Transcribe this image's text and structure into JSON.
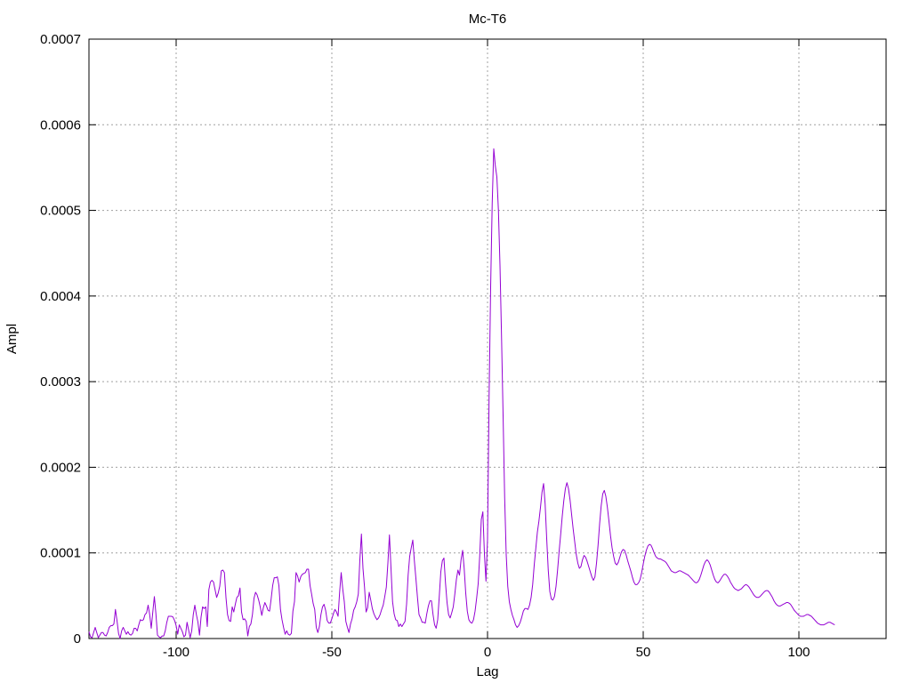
{
  "chart_data": {
    "type": "line",
    "title": "Mc-T6",
    "xlabel": "Lag",
    "ylabel": "Ampl",
    "xlim": [
      -128,
      128
    ],
    "ylim": [
      0,
      0.0007
    ],
    "xticks": [
      -100,
      -50,
      0,
      50,
      100
    ],
    "yticks": [
      0,
      0.0001,
      0.0002,
      0.0003,
      0.0004,
      0.0005,
      0.0006,
      0.0007
    ],
    "xtick_labels": [
      "-100",
      "-50",
      "0",
      "50",
      "100"
    ],
    "ytick_labels": [
      "0",
      "0.0001",
      "0.0002",
      "0.0003",
      "0.0004",
      "0.0005",
      "0.0006",
      "0.0007"
    ],
    "grid": true,
    "legend": "none",
    "series_color": "#9400d3",
    "x": [
      -128,
      -127.5,
      -127,
      -126.5,
      -126,
      -125.5,
      -125,
      -124.5,
      -124,
      -123.5,
      -123,
      -122.5,
      -122,
      -121.5,
      -121,
      -120.5,
      -120,
      -119.5,
      -119,
      -118.5,
      -118,
      -117.5,
      -117,
      -116.5,
      -116,
      -115.5,
      -115,
      -114.5,
      -114,
      -113.5,
      -113,
      -112.5,
      -112,
      -111.5,
      -111,
      -110.5,
      -110,
      -109.5,
      -109,
      -108.5,
      -108,
      -107.5,
      -107,
      -106.5,
      -106,
      -105.5,
      -105,
      -104.5,
      -104,
      -103.5,
      -103,
      -102.5,
      -102,
      -101.5,
      -101,
      -100.5,
      -100,
      -99.5,
      -99,
      -98.5,
      -98,
      -97.5,
      -97,
      -96.5,
      -96,
      -95.5,
      -95,
      -94.5,
      -94,
      -93.5,
      -93,
      -92.5,
      -92,
      -91.5,
      -91,
      -90.5,
      -90,
      -89.5,
      -89,
      -88.5,
      -88,
      -87.5,
      -87,
      -86.5,
      -86,
      -85.5,
      -85,
      -84.5,
      -84,
      -83.5,
      -83,
      -82.5,
      -82,
      -81.5,
      -81,
      -80.5,
      -80,
      -79.5,
      -79,
      -78.5,
      -78,
      -77.5,
      -77,
      -76.5,
      -76,
      -75.5,
      -75,
      -74.5,
      -74,
      -73.5,
      -73,
      -72.5,
      -72,
      -71.5,
      -71,
      -70.5,
      -70,
      -69.5,
      -69,
      -68.5,
      -68,
      -67.5,
      -67,
      -66.5,
      -66,
      -65.5,
      -65,
      -64.5,
      -64,
      -63.5,
      -63,
      -62.5,
      -62,
      -61.5,
      -61,
      -60.5,
      -60,
      -59.5,
      -59,
      -58.5,
      -58,
      -57.5,
      -57,
      -56.5,
      -56,
      -55.5,
      -55,
      -54.5,
      -54,
      -53.5,
      -53,
      -52.5,
      -52,
      -51.5,
      -51,
      -50.5,
      -50,
      -49.5,
      -49,
      -48.5,
      -48,
      -47.5,
      -47,
      -46.5,
      -46,
      -45.5,
      -45,
      -44.5,
      -44,
      -43.5,
      -43,
      -42.5,
      -42,
      -41.5,
      -41,
      -40.5,
      -40,
      -39.5,
      -39,
      -38.5,
      -38,
      -37.5,
      -37,
      -36.5,
      -36,
      -35.5,
      -35,
      -34.5,
      -34,
      -33.5,
      -33,
      -32.5,
      -32,
      -31.5,
      -31,
      -30.5,
      -30,
      -29.5,
      -29,
      -28.5,
      -28,
      -27.5,
      -27,
      -26.5,
      -26,
      -25.5,
      -25,
      -24.5,
      -24,
      -23.5,
      -23,
      -22.5,
      -22,
      -21.5,
      -21,
      -20.5,
      -20,
      -19.5,
      -19,
      -18.5,
      -18,
      -17.5,
      -17,
      -16.5,
      -16,
      -15.5,
      -15,
      -14.5,
      -14,
      -13.5,
      -13,
      -12.5,
      -12,
      -11.5,
      -11,
      -10.5,
      -10,
      -9.5,
      -9,
      -8.5,
      -8,
      -7.5,
      -7,
      -6.5,
      -6,
      -5.5,
      -5,
      -4.5,
      -4,
      -3.5,
      -3,
      -2.5,
      -2,
      -1.5,
      -1,
      -0.5,
      0,
      0.5,
      1,
      1.5,
      2,
      2.5,
      3,
      3.5,
      4,
      4.5,
      5,
      5.5,
      6,
      6.5,
      7,
      7.5,
      8,
      8.5,
      9,
      9.5,
      10,
      10.5,
      11,
      11.5,
      12,
      12.5,
      13,
      13.5,
      14,
      14.5,
      15,
      15.5,
      16,
      16.5,
      17,
      17.5,
      18,
      18.5,
      19,
      19.5,
      20,
      20.5,
      21,
      21.5,
      22,
      22.5,
      23,
      23.5,
      24,
      24.5,
      25,
      25.5,
      26,
      26.5,
      27,
      27.5,
      28,
      28.5,
      29,
      29.5,
      30,
      30.5,
      31,
      31.5,
      32,
      32.5,
      33,
      33.5,
      34,
      34.5,
      35,
      35.5,
      36,
      36.5,
      37,
      37.5,
      38,
      38.5,
      39,
      39.5,
      40,
      40.5,
      41,
      41.5,
      42,
      42.5,
      43,
      43.5,
      44,
      44.5,
      45,
      45.5,
      46,
      46.5,
      47,
      47.5,
      48,
      48.5,
      49,
      49.5,
      50,
      50.5,
      51,
      51.5,
      52,
      52.5,
      53,
      53.5,
      54,
      54.5,
      55,
      55.5,
      56,
      56.5,
      57,
      57.5,
      58,
      58.5,
      59,
      59.5,
      60,
      60.5,
      61,
      61.5,
      62,
      62.5,
      63,
      63.5,
      64,
      64.5,
      65,
      65.5,
      66,
      66.5,
      67,
      67.5,
      68,
      68.5,
      69,
      69.5,
      70,
      70.5,
      71,
      71.5,
      72,
      72.5,
      73,
      73.5,
      74,
      74.5,
      75,
      75.5,
      76,
      76.5,
      77,
      77.5,
      78,
      78.5,
      79,
      79.5,
      80,
      80.5,
      81,
      81.5,
      82,
      82.5,
      83,
      83.5,
      84,
      84.5,
      85,
      85.5,
      86,
      86.5,
      87,
      87.5,
      88,
      88.5,
      89,
      89.5,
      90,
      90.5,
      91,
      91.5,
      92,
      92.5,
      93,
      93.5,
      94,
      94.5,
      95,
      95.5,
      96,
      96.5,
      97,
      97.5,
      98,
      98.5,
      99,
      99.5,
      100,
      100.5,
      101,
      101.5,
      102,
      102.5,
      103,
      103.5,
      104,
      104.5,
      105,
      105.5,
      106,
      106.5,
      107,
      107.5,
      108,
      108.5,
      109,
      109.5,
      110,
      110.5,
      111,
      111.5,
      112,
      112.5,
      113,
      113.5,
      114,
      114.5,
      115,
      115.5,
      116,
      116.5,
      117,
      117.5,
      118,
      118.5,
      119,
      119.5,
      120,
      120.5,
      121,
      121.5,
      122,
      122.5,
      123,
      123.5,
      124,
      124.5,
      125,
      125.5,
      126,
      126.5,
      127,
      127.5,
      128
    ],
    "y": [
      8e-06,
      2e-06,
      1e-06,
      7e-06,
      1.3e-05,
      7e-06,
      1e-06,
      4e-06,
      7e-06,
      7e-06,
      4e-06,
      3e-06,
      7e-06,
      1.3e-05,
      1.5e-05,
      1.5e-05,
      1.7e-05,
      3.4e-05,
      2.1e-05,
      6e-06,
      0,
      9e-06,
      1.3e-05,
      9e-06,
      5e-06,
      8e-06,
      5e-06,
      4e-06,
      6e-06,
      1.2e-05,
      1.2e-05,
      9e-06,
      1.6e-05,
      2.2e-05,
      2.1e-05,
      2.2e-05,
      2.8e-05,
      3e-05,
      3.9e-05,
      2.8e-05,
      1.2e-05,
      3.1e-05,
      4.9e-05,
      2.9e-05,
      4e-06,
      2e-06,
      1e-06,
      3e-06,
      3e-06,
      9e-06,
      1.9e-05,
      2.6e-05,
      2.6e-05,
      2.6e-05,
      2.5e-05,
      2.1e-05,
      1.5e-05,
      5e-06,
      1.6e-05,
      1.2e-05,
      8e-06,
      2e-06,
      4e-06,
      1.9e-05,
      1e-05,
      1e-06,
      9e-06,
      2.8e-05,
      3.9e-05,
      2.8e-05,
      1.9e-05,
      4e-06,
      2.5e-05,
      3.7e-05,
      3.5e-05,
      3.7e-05,
      1.4e-05,
      5.7e-05,
      6.6e-05,
      6.8e-05,
      6.6e-05,
      5.7e-05,
      4.8e-05,
      5.3e-05,
      6.1e-05,
      7.9e-05,
      8e-05,
      7.7e-05,
      4.8e-05,
      2.8e-05,
      2.1e-05,
      2e-05,
      3.7e-05,
      3.1e-05,
      4e-05,
      4.8e-05,
      5e-05,
      5.9e-05,
      3.1e-05,
      2.2e-05,
      2.3e-05,
      2e-05,
      3e-06,
      1.4e-05,
      1.7e-05,
      2.8e-05,
      4.7e-05,
      5.4e-05,
      5.1e-05,
      4.5e-05,
      3.7e-05,
      2.7e-05,
      3.6e-05,
      4.2e-05,
      3.8e-05,
      3.3e-05,
      3.2e-05,
      4.6e-05,
      6.2e-05,
      7.1e-05,
      7.1e-05,
      7.2e-05,
      6.2e-05,
      3.4e-05,
      2.2e-05,
      1.3e-05,
      5e-06,
      9e-06,
      5e-06,
      4e-06,
      6e-06,
      3.2e-05,
      4.3e-05,
      7.7e-05,
      7.3e-05,
      6.6e-05,
      7.2e-05,
      7.5e-05,
      7.6e-05,
      7.7e-05,
      8.1e-05,
      8.1e-05,
      6.2e-05,
      5.2e-05,
      4.1e-05,
      3.4e-05,
      1.3e-05,
      7e-06,
      1.4e-05,
      2.8e-05,
      3.7e-05,
      4e-05,
      3.3e-05,
      2.1e-05,
      1.8e-05,
      1.8e-05,
      2.3e-05,
      2.9e-05,
      3.4e-05,
      3.1e-05,
      2.6e-05,
      5.4e-05,
      7.7e-05,
      5.8e-05,
      4.3e-05,
      2e-05,
      1.3e-05,
      7e-06,
      1.7e-05,
      2.3e-05,
      3.3e-05,
      3.7e-05,
      4.3e-05,
      5.2e-05,
      9.2e-05,
      0.000122,
      8.2e-05,
      6e-05,
      3.1e-05,
      3.6e-05,
      5.4e-05,
      4.5e-05,
      3.5e-05,
      2.9e-05,
      2.5e-05,
      2.2e-05,
      2.4e-05,
      2.8e-05,
      3.4e-05,
      3.9e-05,
      4.9e-05,
      6e-05,
      8.8e-05,
      0.000121,
      8.2e-05,
      4.3e-05,
      2.9e-05,
      2.2e-05,
      2.1e-05,
      1.4e-05,
      1.7e-05,
      1.4e-05,
      1.7e-05,
      2e-05,
      4e-05,
      7.4e-05,
      9.6e-05,
      0.000106,
      0.000115,
      9.1e-05,
      7e-05,
      4.8e-05,
      2.8e-05,
      2.4e-05,
      1.9e-05,
      1.9e-05,
      1.8e-05,
      2.9e-05,
      3.8e-05,
      4.4e-05,
      4.4e-05,
      2.8e-05,
      1.6e-05,
      1.2e-05,
      2.2e-05,
      4.9e-05,
      7.8e-05,
      9.1e-05,
      9.4e-05,
      6.5e-05,
      4.2e-05,
      2.8e-05,
      2.4e-05,
      3e-05,
      3.7e-05,
      5.2e-05,
      6.9e-05,
      8e-05,
      7.4e-05,
      9.2e-05,
      0.000103,
      8.2e-05,
      5.3e-05,
      3.2e-05,
      2.2e-05,
      1.9e-05,
      1.8e-05,
      2.2e-05,
      3.2e-05,
      4.7e-05,
      6.4e-05,
      9.7e-05,
      0.000139,
      0.000148,
      9.9e-05,
      6.7e-05,
      0.000116,
      0.000282,
      0.00041,
      0.000508,
      0.000572,
      0.000552,
      0.000539,
      0.0005,
      0.000436,
      0.000352,
      0.00026,
      0.000165,
      9.8e-05,
      6.1e-05,
      4.3e-05,
      3.4e-05,
      2.7e-05,
      2.2e-05,
      1.6e-05,
      1.3e-05,
      1.5e-05,
      1.9e-05,
      2.5e-05,
      3.2e-05,
      3.5e-05,
      3.5e-05,
      3.4e-05,
      3.9e-05,
      4.8e-05,
      6.3e-05,
      8.6e-05,
      0.000105,
      0.000124,
      0.000137,
      0.000153,
      0.000171,
      0.000181,
      0.000157,
      0.000117,
      8e-05,
      5.5e-05,
      4.6e-05,
      4.5e-05,
      4.9e-05,
      6.1e-05,
      8e-05,
      0.000102,
      0.000122,
      0.000143,
      0.000161,
      0.000175,
      0.000182,
      0.000175,
      0.000162,
      0.000145,
      0.000128,
      0.000113,
      9.8e-05,
      8.8e-05,
      8.2e-05,
      8.4e-05,
      9.2e-05,
      9.7e-05,
      9.5e-05,
      9e-05,
      8.4e-05,
      7.8e-05,
      7.2e-05,
      6.8e-05,
      7.2e-05,
      8.8e-05,
      0.000109,
      0.000134,
      0.000155,
      0.000169,
      0.000173,
      0.000166,
      0.000153,
      0.000137,
      0.00012,
      0.000106,
      9.6e-05,
      8.8e-05,
      8.6e-05,
      8.9e-05,
      9.5e-05,
      0.000101,
      0.000104,
      0.000103,
      9.8e-05,
      9.1e-05,
      8.5e-05,
      7.9e-05,
      7.2e-05,
      6.6e-05,
      6.3e-05,
      6.3e-05,
      6.5e-05,
      6.9e-05,
      7.7e-05,
      8.7e-05,
      9.6e-05,
      0.000103,
      0.000108,
      0.00011,
      0.000109,
      0.000105,
      0.0001,
      9.6e-05,
      9.4e-05,
      9.3e-05,
      9.3e-05,
      9.2e-05,
      9.1e-05,
      9e-05,
      8.8e-05,
      8.5e-05,
      8.2e-05,
      7.9e-05,
      7.8e-05,
      7.7e-05,
      7.7e-05,
      7.8e-05,
      7.9e-05,
      7.9e-05,
      7.8e-05,
      7.7e-05,
      7.6e-05,
      7.5e-05,
      7.4e-05,
      7.2e-05,
      7e-05,
      6.8e-05,
      6.6e-05,
      6.5e-05,
      6.6e-05,
      6.9e-05,
      7.4e-05,
      8e-05,
      8.6e-05,
      9e-05,
      9.2e-05,
      9e-05,
      8.6e-05,
      8e-05,
      7.4e-05,
      6.9e-05,
      6.6e-05,
      6.5e-05,
      6.7e-05,
      7e-05,
      7.3e-05,
      7.5e-05,
      7.5e-05,
      7.3e-05,
      7e-05,
      6.6e-05,
      6.3e-05,
      6e-05,
      5.8e-05,
      5.7e-05,
      5.6e-05,
      5.7e-05,
      5.8e-05,
      6e-05,
      6.2e-05,
      6.3e-05,
      6.2e-05,
      6e-05,
      5.7e-05,
      5.4e-05,
      5.1e-05,
      4.9e-05,
      4.8e-05,
      4.8e-05,
      4.9e-05,
      5.1e-05,
      5.3e-05,
      5.5e-05,
      5.6e-05,
      5.6e-05,
      5.4e-05,
      5.1e-05,
      4.8e-05,
      4.4e-05,
      4.1e-05,
      3.9e-05,
      3.8e-05,
      3.8e-05,
      3.9e-05,
      4e-05,
      4.1e-05,
      4.2e-05,
      4.2e-05,
      4.1e-05,
      3.9e-05,
      3.6e-05,
      3.3e-05,
      3.1e-05,
      2.9e-05,
      2.7e-05,
      2.6e-05,
      2.6e-05,
      2.6e-05,
      2.7e-05,
      2.8e-05,
      2.8e-05,
      2.7e-05,
      2.6e-05,
      2.4e-05,
      2.2e-05,
      2e-05,
      1.8e-05,
      1.7e-05,
      1.6e-05,
      1.6e-05,
      1.6e-05,
      1.7e-05,
      1.8e-05,
      1.9e-05,
      1.9e-05,
      1.8e-05,
      1.7e-05,
      1.6e-05
    ]
  }
}
